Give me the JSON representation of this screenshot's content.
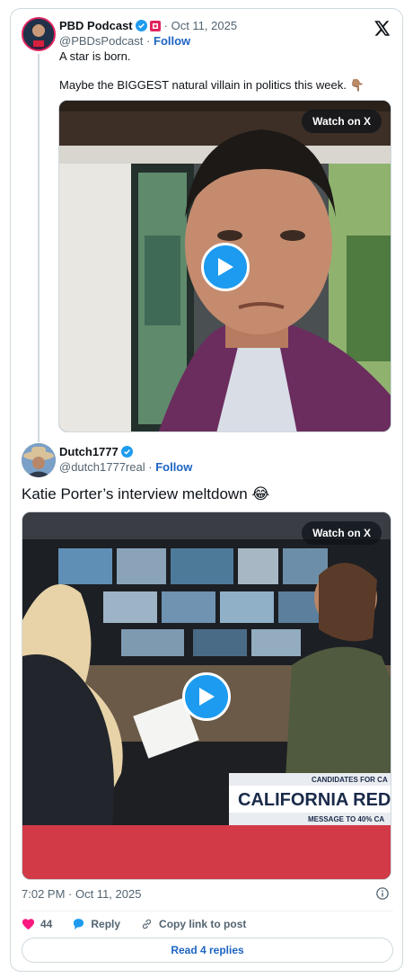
{
  "quoted_tweet": {
    "author_name": "PBD Podcast",
    "date": "· Oct 11, 2025",
    "handle": "@PBDsPodcast",
    "follow_label": "Follow",
    "handle_separator": "·",
    "line1": "A star is born.",
    "line2": "Maybe the BIGGEST natural villain in politics this week. 👇🏽",
    "watch_label": "Watch on X"
  },
  "main_tweet": {
    "author_name": "Dutch1777",
    "handle": "@dutch1777real",
    "handle_separator": "·",
    "follow_label": "Follow",
    "text": "Katie Porter’s interview meltdown 😂",
    "watch_label": "Watch on X",
    "chyron_small": "CANDIDATES FOR CA",
    "chyron_main": "CALIFORNIA REDIST",
    "chyron_sub": "MESSAGE TO 40% CA",
    "timestamp": "7:02 PM · Oct 11, 2025"
  },
  "actions": {
    "likes_count": "44",
    "reply_label": "Reply",
    "copy_label": "Copy link to post",
    "read_replies_label": "Read 4 replies"
  },
  "colors": {
    "accent": "#1d9bf0",
    "link": "#1d64c3",
    "like": "#f91880",
    "muted": "#536471"
  }
}
